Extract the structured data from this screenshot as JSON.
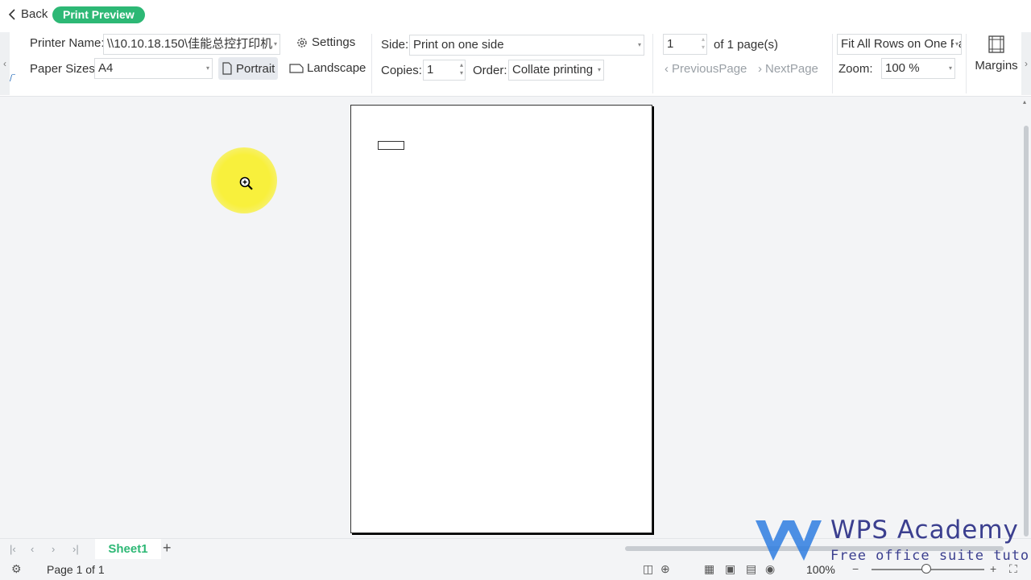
{
  "topbar": {
    "back_label": "Back",
    "mode_label": "Print Preview"
  },
  "ribbon": {
    "printer_label": "Printer Name:",
    "printer_value": "\\\\10.10.18.150\\佳能总控打印机",
    "settings_label": "Settings",
    "paper_label": "Paper Sizes:",
    "paper_value": "A4",
    "portrait_label": "Portrait",
    "landscape_label": "Landscape",
    "side_label": "Side:",
    "side_value": "Print on one side",
    "copies_label": "Copies:",
    "copies_value": "1",
    "order_label": "Order:",
    "order_value": "Collate printing",
    "page_value": "1",
    "page_of": "of 1 page(s)",
    "prev_label": "PreviousPage",
    "next_label": "NextPage",
    "fit_value": "Fit All Rows on One Page",
    "zoom_label": "Zoom:",
    "zoom_value": "100 %",
    "margins_label": "Margins"
  },
  "tabs": {
    "sheet_name": "Sheet1"
  },
  "status": {
    "page_text": "Page 1 of 1",
    "zoom_text": "100%"
  },
  "watermark": {
    "title": "WPS Academy",
    "subtitle": "Free office suite tutorials"
  },
  "colors": {
    "accent": "#2db875",
    "brand": "#3b3f8f",
    "highlight": "#f8f03c"
  }
}
